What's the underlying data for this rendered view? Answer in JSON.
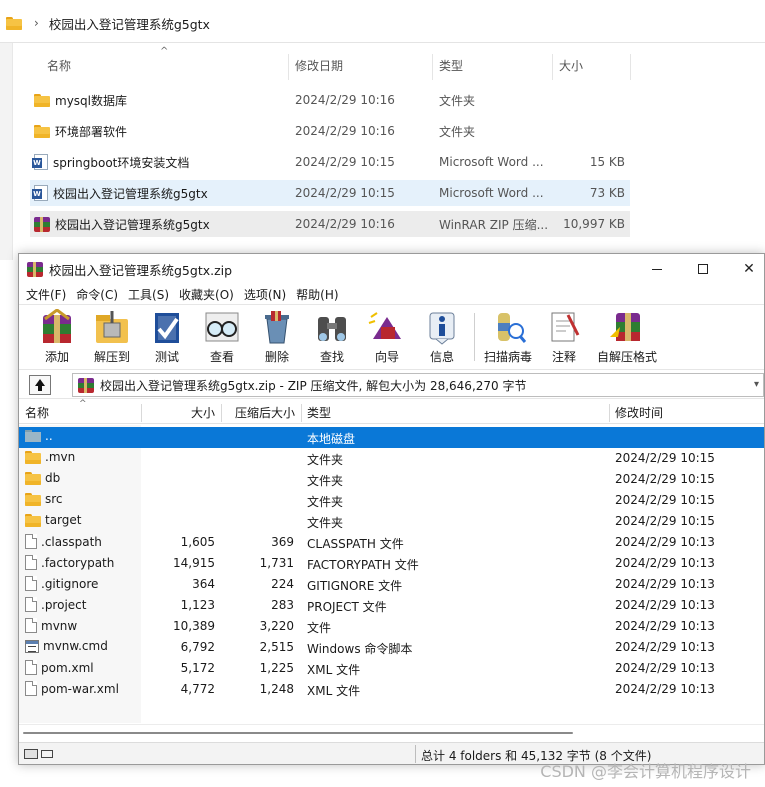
{
  "explorer": {
    "breadcrumb": "校园出入登记管理系统g5gtx",
    "headers": {
      "name": "名称",
      "date": "修改日期",
      "type": "类型",
      "size": "大小"
    },
    "rows": [
      {
        "icon": "folder-icon",
        "name": "mysql数据库",
        "date": "2024/2/29 10:16",
        "type": "文件夹",
        "size": ""
      },
      {
        "icon": "folder-icon",
        "name": "环境部署软件",
        "date": "2024/2/29 10:16",
        "type": "文件夹",
        "size": ""
      },
      {
        "icon": "word-doc-icon",
        "name": "springboot环境安装文档",
        "date": "2024/2/29 10:15",
        "type": "Microsoft Word ...",
        "size": "15 KB"
      },
      {
        "icon": "word-doc-icon",
        "name": "校园出入登记管理系统g5gtx",
        "date": "2024/2/29 10:15",
        "type": "Microsoft Word ...",
        "size": "73 KB"
      },
      {
        "icon": "winrar-archive-icon",
        "name": "校园出入登记管理系统g5gtx",
        "date": "2024/2/29 10:16",
        "type": "WinRAR ZIP 压缩...",
        "size": "10,997 KB"
      }
    ]
  },
  "winrar": {
    "title": "校园出入登记管理系统g5gtx.zip",
    "menu": [
      "文件(F)",
      "命令(C)",
      "工具(S)",
      "收藏夹(O)",
      "选项(N)",
      "帮助(H)"
    ],
    "toolbar": [
      "添加",
      "解压到",
      "测试",
      "查看",
      "删除",
      "查找",
      "向导",
      "信息",
      "扫描病毒",
      "注释",
      "自解压格式"
    ],
    "address": "校园出入登记管理系统g5gtx.zip - ZIP 压缩文件, 解包大小为 28,646,270 字节",
    "columns": {
      "name": "名称",
      "size": "大小",
      "packed": "压缩后大小",
      "type": "类型",
      "modified": "修改时间"
    },
    "rows": [
      {
        "icon": "parent-folder-icon",
        "name": "..",
        "size": "",
        "packed": "",
        "type": "本地磁盘",
        "modified": ""
      },
      {
        "icon": "folder-icon",
        "name": ".mvn",
        "size": "",
        "packed": "",
        "type": "文件夹",
        "modified": "2024/2/29 10:15"
      },
      {
        "icon": "folder-icon",
        "name": "db",
        "size": "",
        "packed": "",
        "type": "文件夹",
        "modified": "2024/2/29 10:15"
      },
      {
        "icon": "folder-icon",
        "name": "src",
        "size": "",
        "packed": "",
        "type": "文件夹",
        "modified": "2024/2/29 10:15"
      },
      {
        "icon": "folder-icon",
        "name": "target",
        "size": "",
        "packed": "",
        "type": "文件夹",
        "modified": "2024/2/29 10:15"
      },
      {
        "icon": "file-icon",
        "name": ".classpath",
        "size": "1,605",
        "packed": "369",
        "type": "CLASSPATH 文件",
        "modified": "2024/2/29 10:13"
      },
      {
        "icon": "file-icon",
        "name": ".factorypath",
        "size": "14,915",
        "packed": "1,731",
        "type": "FACTORYPATH 文件",
        "modified": "2024/2/29 10:13"
      },
      {
        "icon": "file-icon",
        "name": ".gitignore",
        "size": "364",
        "packed": "224",
        "type": "GITIGNORE 文件",
        "modified": "2024/2/29 10:13"
      },
      {
        "icon": "file-icon",
        "name": ".project",
        "size": "1,123",
        "packed": "283",
        "type": "PROJECT 文件",
        "modified": "2024/2/29 10:13"
      },
      {
        "icon": "file-icon",
        "name": "mvnw",
        "size": "10,389",
        "packed": "3,220",
        "type": "文件",
        "modified": "2024/2/29 10:13"
      },
      {
        "icon": "cmd-script-icon",
        "name": "mvnw.cmd",
        "size": "6,792",
        "packed": "2,515",
        "type": "Windows 命令脚本",
        "modified": "2024/2/29 10:13"
      },
      {
        "icon": "file-icon",
        "name": "pom.xml",
        "size": "5,172",
        "packed": "1,225",
        "type": "XML 文件",
        "modified": "2024/2/29 10:13"
      },
      {
        "icon": "file-icon",
        "name": "pom-war.xml",
        "size": "4,772",
        "packed": "1,248",
        "type": "XML 文件",
        "modified": "2024/2/29 10:13"
      }
    ],
    "status": "总计 4 folders 和 45,132 字节 (8 个文件)"
  },
  "watermark": "CSDN @李会计算机程序设计"
}
